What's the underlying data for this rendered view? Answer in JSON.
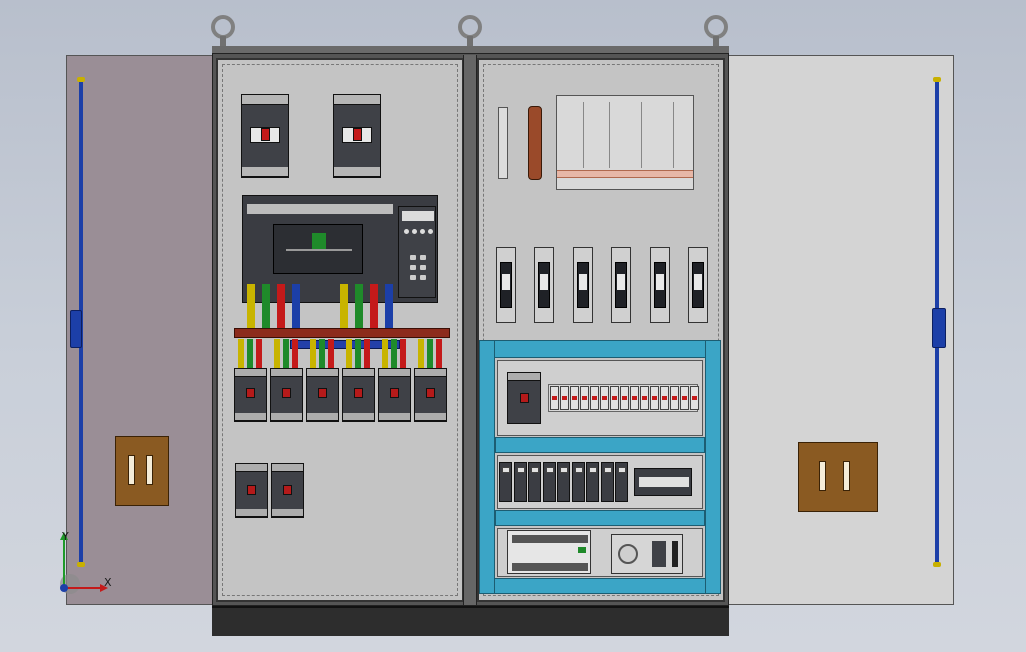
{
  "axis_triad": {
    "x_label": "X",
    "y_label": "Y"
  },
  "colors": {
    "busbar": "#8c2b1c",
    "phase_l1": "#c8b400",
    "phase_l2": "#1f8a2a",
    "phase_l3": "#c41a1a",
    "neutral": "#1c3fa8",
    "control_frame": "#3ba5c6",
    "door_left": "#9a8e96",
    "door_right": "#d4d4d4"
  },
  "icons": {
    "eyebolt": "eyebolt-icon",
    "lock": "door-lock-icon",
    "hinge": "door-hinge-icon"
  }
}
